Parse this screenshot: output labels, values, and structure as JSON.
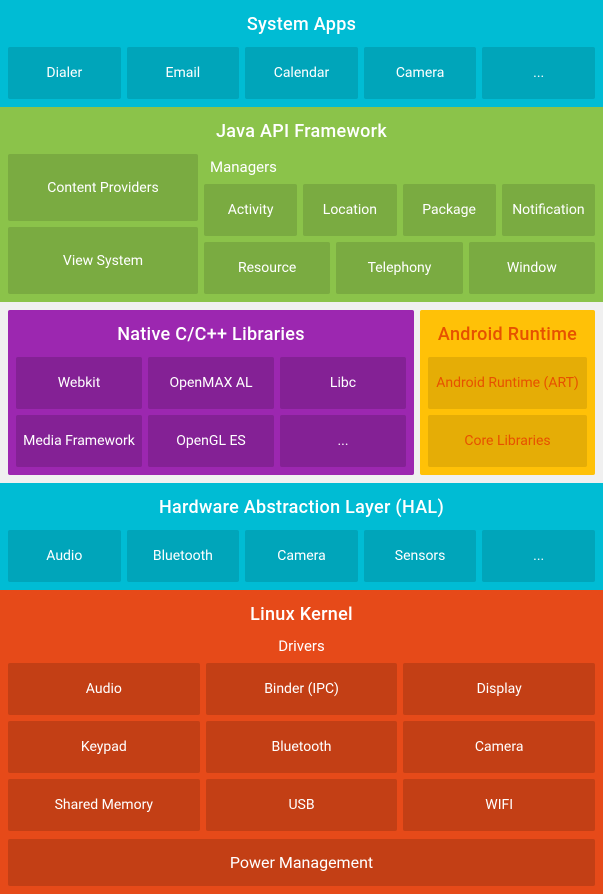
{
  "systemApps": {
    "title": "System Apps",
    "items": [
      "Dialer",
      "Email",
      "Calendar",
      "Camera",
      "..."
    ]
  },
  "javaApi": {
    "title": "Java API Framework",
    "left": [
      "Content Providers",
      "View System"
    ],
    "managersTitle": "Managers",
    "managers": [
      [
        "Activity",
        "Location",
        "Package",
        "Notification"
      ],
      [
        "Resource",
        "Telephony",
        "Window"
      ]
    ]
  },
  "native": {
    "title": "Native C/C++ Libraries",
    "row1": [
      "Webkit",
      "OpenMAX AL",
      "Libc"
    ],
    "row2": [
      "Media Framework",
      "OpenGL ES",
      "..."
    ]
  },
  "runtime": {
    "title": "Android Runtime",
    "row1": "Android Runtime (ART)",
    "row2": "Core Libraries"
  },
  "hal": {
    "title": "Hardware Abstraction Layer (HAL)",
    "items": [
      "Audio",
      "Bluetooth",
      "Camera",
      "Sensors",
      "..."
    ]
  },
  "linux": {
    "title": "Linux Kernel",
    "driversTitle": "Drivers",
    "drivers": [
      [
        "Audio",
        "Binder (IPC)",
        "Display"
      ],
      [
        "Keypad",
        "Bluetooth",
        "Camera"
      ],
      [
        "Shared Memory",
        "USB",
        "WIFI"
      ]
    ],
    "powerManagement": "Power Management"
  }
}
